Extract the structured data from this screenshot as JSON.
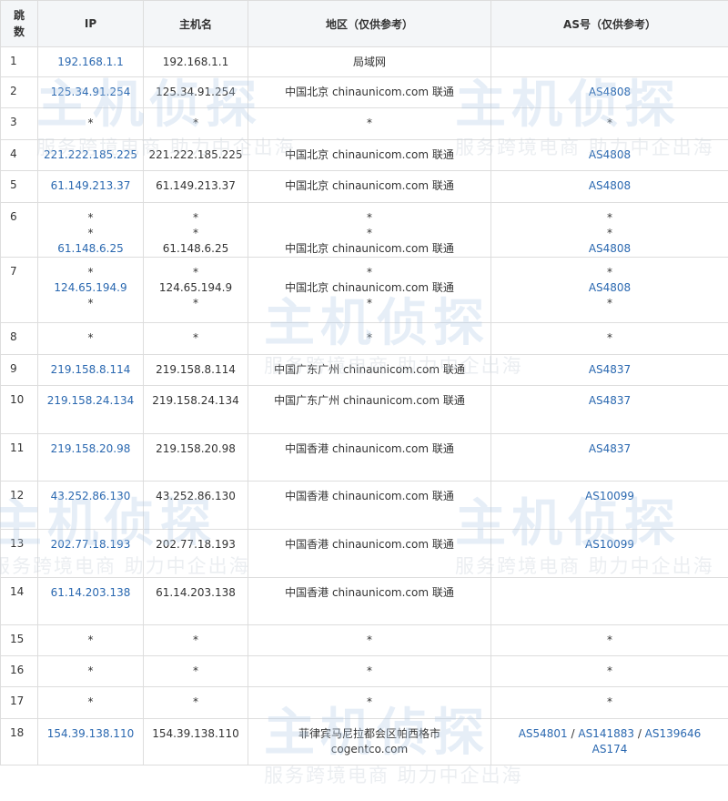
{
  "header": {
    "hop_line1": "跳",
    "hop_line2": "数",
    "ip": "IP",
    "hostname": "主机名",
    "region": "地区（仅供参考）",
    "as": "AS号（仅供参考）"
  },
  "rows": [
    {
      "hop": "1",
      "ips": [
        "192.168.1.1"
      ],
      "hosts": [
        "192.168.1.1"
      ],
      "regions": [
        "局域网"
      ],
      "as": [
        []
      ]
    },
    {
      "hop": "2",
      "ips": [
        "125.34.91.254"
      ],
      "hosts": [
        "125.34.91.254"
      ],
      "regions": [
        "中国北京 chinaunicom.com 联通"
      ],
      "as": [
        [
          "AS4808"
        ]
      ]
    },
    {
      "hop": "3",
      "ips": [
        "*"
      ],
      "hosts": [
        "*"
      ],
      "regions": [
        "*"
      ],
      "as": [
        [
          "*"
        ]
      ]
    },
    {
      "hop": "4",
      "ips": [
        "221.222.185.225"
      ],
      "hosts": [
        "221.222.185.225"
      ],
      "regions": [
        "中国北京 chinaunicom.com 联通"
      ],
      "as": [
        [
          "AS4808"
        ]
      ]
    },
    {
      "hop": "5",
      "ips": [
        "61.149.213.37"
      ],
      "hosts": [
        "61.149.213.37"
      ],
      "regions": [
        "中国北京 chinaunicom.com 联通"
      ],
      "as": [
        [
          "AS4808"
        ]
      ]
    },
    {
      "hop": "6",
      "ips": [
        "*",
        "*",
        "61.148.6.25"
      ],
      "hosts": [
        "*",
        "*",
        "61.148.6.25"
      ],
      "regions": [
        "*",
        "*",
        "中国北京 chinaunicom.com 联通"
      ],
      "as": [
        [
          "*"
        ],
        [
          "*"
        ],
        [
          "AS4808"
        ]
      ]
    },
    {
      "hop": "7",
      "ips": [
        "*",
        "124.65.194.9",
        "*"
      ],
      "hosts": [
        "*",
        "124.65.194.9",
        "*"
      ],
      "regions": [
        "*",
        "中国北京 chinaunicom.com 联通",
        "*"
      ],
      "as": [
        [
          "*"
        ],
        [
          "AS4808"
        ],
        [
          "*"
        ]
      ]
    },
    {
      "hop": "8",
      "ips": [
        "*"
      ],
      "hosts": [
        "*"
      ],
      "regions": [
        "*"
      ],
      "as": [
        [
          "*"
        ]
      ]
    },
    {
      "hop": "9",
      "ips": [
        "219.158.8.114"
      ],
      "hosts": [
        "219.158.8.114"
      ],
      "regions": [
        "中国广东广州 chinaunicom.com 联通"
      ],
      "as": [
        [
          "AS4837"
        ]
      ]
    },
    {
      "hop": "10",
      "ips": [
        "219.158.24.134"
      ],
      "hosts": [
        "219.158.24.134"
      ],
      "regions": [
        "中国广东广州 chinaunicom.com 联通"
      ],
      "as": [
        [
          "AS4837"
        ]
      ]
    },
    {
      "hop": "11",
      "ips": [
        "219.158.20.98"
      ],
      "hosts": [
        "219.158.20.98"
      ],
      "regions": [
        "中国香港 chinaunicom.com 联通"
      ],
      "as": [
        [
          "AS4837"
        ]
      ]
    },
    {
      "hop": "12",
      "ips": [
        "43.252.86.130"
      ],
      "hosts": [
        "43.252.86.130"
      ],
      "regions": [
        "中国香港 chinaunicom.com 联通"
      ],
      "as": [
        [
          "AS10099"
        ]
      ]
    },
    {
      "hop": "13",
      "ips": [
        "202.77.18.193"
      ],
      "hosts": [
        "202.77.18.193"
      ],
      "regions": [
        "中国香港 chinaunicom.com 联通"
      ],
      "as": [
        [
          "AS10099"
        ]
      ]
    },
    {
      "hop": "14",
      "ips": [
        "61.14.203.138"
      ],
      "hosts": [
        "61.14.203.138"
      ],
      "regions": [
        "中国香港 chinaunicom.com 联通"
      ],
      "as": [
        []
      ]
    },
    {
      "hop": "15",
      "ips": [
        "*"
      ],
      "hosts": [
        "*"
      ],
      "regions": [
        "*"
      ],
      "as": [
        [
          "*"
        ]
      ]
    },
    {
      "hop": "16",
      "ips": [
        "*"
      ],
      "hosts": [
        "*"
      ],
      "regions": [
        "*"
      ],
      "as": [
        [
          "*"
        ]
      ]
    },
    {
      "hop": "17",
      "ips": [
        "*"
      ],
      "hosts": [
        "*"
      ],
      "regions": [
        "*"
      ],
      "as": [
        [
          "*"
        ]
      ]
    },
    {
      "hop": "18",
      "ips": [
        "154.39.138.110"
      ],
      "hosts": [
        "154.39.138.110"
      ],
      "regions": [
        "菲律宾马尼拉都会区帕西格市",
        "cogentco.com"
      ],
      "as": [
        [
          "AS54801",
          "AS141883",
          "AS139646"
        ],
        [
          "AS174"
        ]
      ]
    }
  ],
  "as_separator": " / ",
  "watermark": {
    "brand": "主机侦探",
    "slogan": "服务跨境电商 助力中企出海"
  },
  "colors": {
    "link": "#2a68b0",
    "border": "#dddddd",
    "header_bg": "#f4f6f8"
  }
}
